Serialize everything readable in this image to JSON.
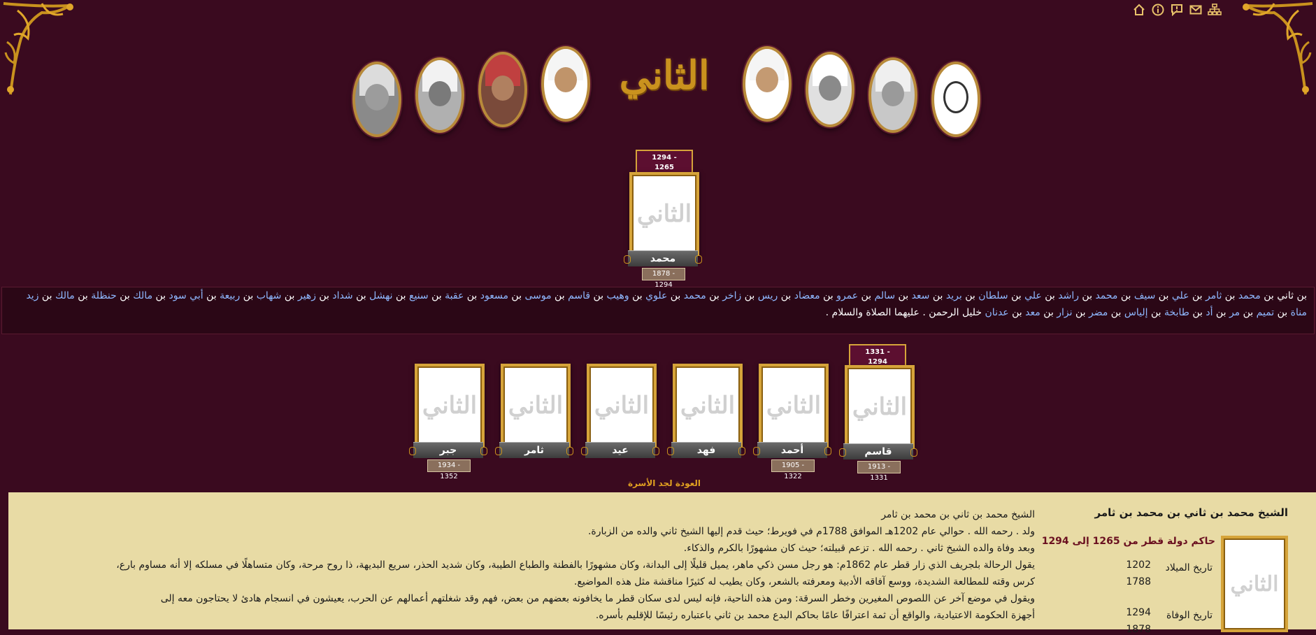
{
  "brand": {
    "logo_text": "الثاني"
  },
  "top_nav": [
    {
      "name": "home-icon"
    },
    {
      "name": "info-icon"
    },
    {
      "name": "message-icon"
    },
    {
      "name": "mail-icon"
    },
    {
      "name": "sitemap-icon"
    }
  ],
  "root": {
    "years_box": "1294 - 1265",
    "name": "محمد",
    "dates": "1878 - 1294"
  },
  "lineage": [
    "بن ثاني بن ",
    "محمد",
    " بن ",
    "ثامر",
    " بن ",
    "علي",
    " بن ",
    "سيف",
    " بن ",
    "محمد",
    " بن ",
    "راشد",
    " بن ",
    "علي",
    " بن ",
    "سلطان",
    " بن ",
    "بريد",
    " بن ",
    "سعد",
    " بن ",
    "سالم",
    " بن ",
    "عمرو",
    " بن ",
    "معضاد",
    " بن ",
    "ريس",
    " بن ",
    "زاخر",
    " بن ",
    "محمد",
    " بن ",
    "علوي",
    " بن ",
    "وهيب",
    " بن ",
    "قاسم",
    " بن ",
    "موسى",
    " بن ",
    "مسعود",
    " بن ",
    "عقبة",
    " بن ",
    "سنيع",
    " بن ",
    "نهشل",
    " بن ",
    "شداد",
    " بن ",
    "زهير",
    " بن ",
    "شهاب",
    " بن ",
    "ربيعة",
    " بن ",
    "أبي سود",
    " بن ",
    "مالك",
    " بن ",
    "حنظلة",
    " بن ",
    "مالك",
    " بن ",
    "زيد مناة",
    " بن ",
    "تميم",
    " بن ",
    "مر",
    " بن ",
    "أد",
    " بن ",
    "طابخة",
    " بن ",
    "إلياس",
    " بن ",
    "مضر",
    " بن ",
    "نزار",
    " بن ",
    "معد",
    " بن ",
    "عدنان",
    " خليل الرحمن . عليهما الصلاة والسلام ."
  ],
  "children": [
    {
      "name": "قاسم",
      "dates": "1913 - 1331",
      "years_box": "1331 - 1294"
    },
    {
      "name": "أحمد",
      "dates": "1905 - 1322"
    },
    {
      "name": "فهد",
      "dates": ""
    },
    {
      "name": "عيد",
      "dates": ""
    },
    {
      "name": "ثامر",
      "dates": ""
    },
    {
      "name": "جبر",
      "dates": "1934 - 1352"
    }
  ],
  "back_link": "العودة لجد الأسرة",
  "detail": {
    "title": "الشيخ محمد بن ثاني بن محمد بن ثامر",
    "subtitle": "حاكم دولة قطر من 1265 إلى 1294",
    "birth_label": "تاريخ الميلاد",
    "birth_hijri": "1202",
    "birth_greg": "1788",
    "death_label": "تاريخ الوفاة",
    "death_hijri": "1294",
    "death_greg": "1878",
    "paragraphs": [
      "الشيخ محمد بن ثاني بن محمد بن ثامر",
      "ولد . رحمه الله . حوالي عام 1202هـ الموافق 1788م في فويرط؛ حيث قدم إليها الشيخ ثاني والده من الزبارة.",
      "وبعد وفاة والده الشيخ ثاني . رحمه الله . تزعم قبيلته؛ حيث كان مشهورًا بالكرم والذكاء.",
      "يقول الرحالة بلجريف الذي زار قطر عام 1862م: هو رجل مسن ذكي ماهر، يميل قليلًا إلى البدانة، وكان مشهورًا بالفطنة والطباع الطيبة، وكان شديد الحذر، سريع البديهة، ذا روح مرحة، وكان متساهلًا في مسلكه إلا أنه مساوم بارع،",
      "كرس وقته للمطالعة الشديدة، ووسع آفاقه الأدبية ومعرفته بالشعر، وكان يطيب له كثيرًا مناقشة مثل هذه المواضيع.",
      "ويقول في موضع آخر عن اللصوص المغيرين وخطر السرقة: ومن هذه الناحية، فإنه ليس لدى سكان قطر ما يخافونه بعضهم من بعض، فهم وقد شغلتهم أعمالهم عن الحرب، يعيشون في انسجام هادئ لا يحتاجون معه إلى",
      "أجهزة الحكومة الاعتيادية، والواقع أن ثمة اعترافًا عامًا بحاكم البدع محمد بن ثاني باعتباره رئيسًا للإقليم بأسره."
    ]
  }
}
